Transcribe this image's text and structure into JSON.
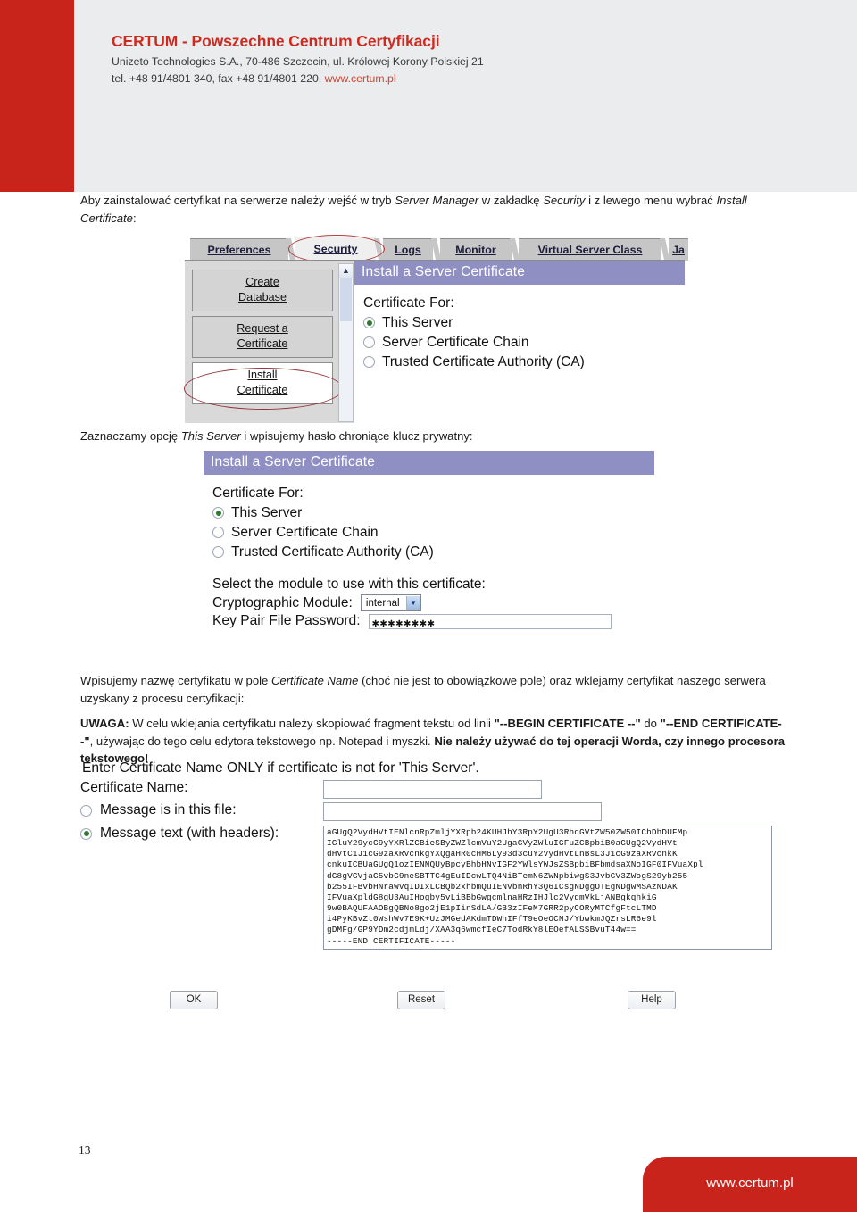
{
  "header": {
    "company_title": "CERTUM - Powszechne Centrum Certyfikacji",
    "address_line": "Unizeto Technologies S.A., 70-486 Szczecin, ul. Królowej Korony Polskiej 21",
    "contact_prefix": "tel. +48 91/4801 340, fax +48 91/4801 220, ",
    "contact_link": "www.certum.pl"
  },
  "body": {
    "para1_a": "Aby zainstalować certyfikat na serwerze należy wejść w tryb ",
    "para1_it1": "Server Manager",
    "para1_b": " w zakładkę ",
    "para1_it2": "Security",
    "para1_c": " i z lewego menu wybrać ",
    "para1_it3": "Install Certificate",
    "para1_d": ":",
    "para2_a": "Zaznaczamy opcję ",
    "para2_it": "This Server",
    "para2_b": " i wpisujemy hasło chroniące klucz prywatny:",
    "para3_a": "Wpisujemy nazwę certyfikatu w pole ",
    "para3_it": "Certificate Name",
    "para3_b": " (choć nie jest to obowiązkowe pole) oraz wklejamy certyfikat naszego serwera uzyskany z procesu certyfikacji:",
    "warn_label": "UWAGA:",
    "warn_a": " W celu wklejania certyfikatu należy skopiować fragment tekstu od linii ",
    "warn_b1": "\"--BEGIN CERTIFICATE --\"",
    "warn_c": " do ",
    "warn_b2": "\"--END CERTIFICATE--\"",
    "warn_d": ", używając do tego celu edytora tekstowego np. Notepad i myszki. ",
    "warn_b3": "Nie należy używać do tej operacji Worda, czy innego procesora tekstowego!"
  },
  "shot1": {
    "tabs": [
      {
        "label": "Preferences",
        "selected": false
      },
      {
        "label": "Security",
        "selected": true
      },
      {
        "label": "Logs",
        "selected": false
      },
      {
        "label": "Monitor",
        "selected": false
      },
      {
        "label": "Virtual Server Class",
        "selected": false
      },
      {
        "label": "Ja",
        "selected": false
      }
    ],
    "nav_buttons": [
      {
        "line1": "Create",
        "line2": "Database",
        "highlighted": false
      },
      {
        "line1": "Request a",
        "line2": "Certificate",
        "highlighted": false
      },
      {
        "line1": "Install",
        "line2": "Certificate",
        "highlighted": true
      }
    ],
    "panel_title": "Install a Server Certificate",
    "section_label": "Certificate For:",
    "options": [
      {
        "label": "This Server",
        "selected": true
      },
      {
        "label": "Server Certificate Chain",
        "selected": false
      },
      {
        "label": "Trusted Certificate Authority (CA)",
        "selected": false
      }
    ],
    "scroll_up_icon": "chevron-up-icon"
  },
  "shot2": {
    "panel_title": "Install a Server Certificate",
    "section_label": "Certificate For:",
    "options": [
      {
        "label": "This Server",
        "selected": true
      },
      {
        "label": "Server Certificate Chain",
        "selected": false
      },
      {
        "label": "Trusted Certificate Authority (CA)",
        "selected": false
      }
    ],
    "module_hint": "Select the module to use with this certificate:",
    "module_label": "Cryptographic Module:",
    "module_value": "internal",
    "module_arrow": "chevron-down-icon",
    "password_label": "Key Pair File Password:",
    "password_value": "✱✱✱✱✱✱✱✱"
  },
  "shot3": {
    "hint": "Enter Certificate Name ONLY if certificate is not for 'This Server'.",
    "cert_name_label": "Certificate Name:",
    "cert_name_value": "",
    "msg_file_label": "Message is in this file:",
    "msg_file_selected": false,
    "msg_file_value": "",
    "msg_text_label": "Message text (with headers):",
    "msg_text_selected": true,
    "cert_text": "aGUgQ2VydHVtIENlcnRpZmljYXRpb24KUHJhY3RpY2UgU3RhdGVtZW50ZW50IChDhDUFMp\nIGluY29ycG9yYXRlZCBieSByZWZlcmVuY2UgaGVyZWluIGFuZCBpbiB0aGUgQ2VydHVt\ndHVtC1J1cG9zaXRvcnkgYXQgaHR0cHM6Ly93d3cuY2VydHVtLnBsL3J1cG9zaXRvcnkK\ncnkuICBUaGUgQ1ozIENNQUyBpcyBhbHNvIGF2YWlsYWJsZSBpbiBFbmdsaXNoIGF0IFVuaXpl\ndG8gVGVjaG5vbG9neSBTTC4gEuIDcwLTQ4NiBTemN6ZWNpbiwgS3JvbGV3ZWogS29yb255\nb255IFBvbHNraWVqIDIxLCBQb2xhbmQuIENvbnRhY3Q6ICsgNDggOTEgNDgwMSAzNDAK\nIFVuaXpldG8gU3AuIHogby5vLiBBbGwgcmlnaHRzIHJlc2VydmVkLjANBgkqhkiG\n9w0BAQUFAAOBgQBNo8go2jE1pIinSdLA/GB3zIFeM7GRR2pyCORyMTCfgFtcLTMD\ni4PyKBvZt0WshWv7E9K+UzJMGedAKdmTDWhIFfT9eOeOCNJ/YbwkmJQZrsLR6e9l\ngDMFg/GP9YDm2cdjmLdj/XAA3q6wmcfIeC7TodRkY8lEOefALSSBvuT44w==\n-----END CERTIFICATE-----",
    "buttons": [
      {
        "label": "OK"
      },
      {
        "label": "Reset"
      },
      {
        "label": "Help"
      }
    ]
  },
  "footer": {
    "page_number": "13",
    "badge_text": "www.certum.pl"
  },
  "colors": {
    "brand_red": "#c9241c",
    "title_red": "#cf2a20",
    "panel_purple": "#8f8fc4",
    "header_bg": "#ebecee"
  }
}
